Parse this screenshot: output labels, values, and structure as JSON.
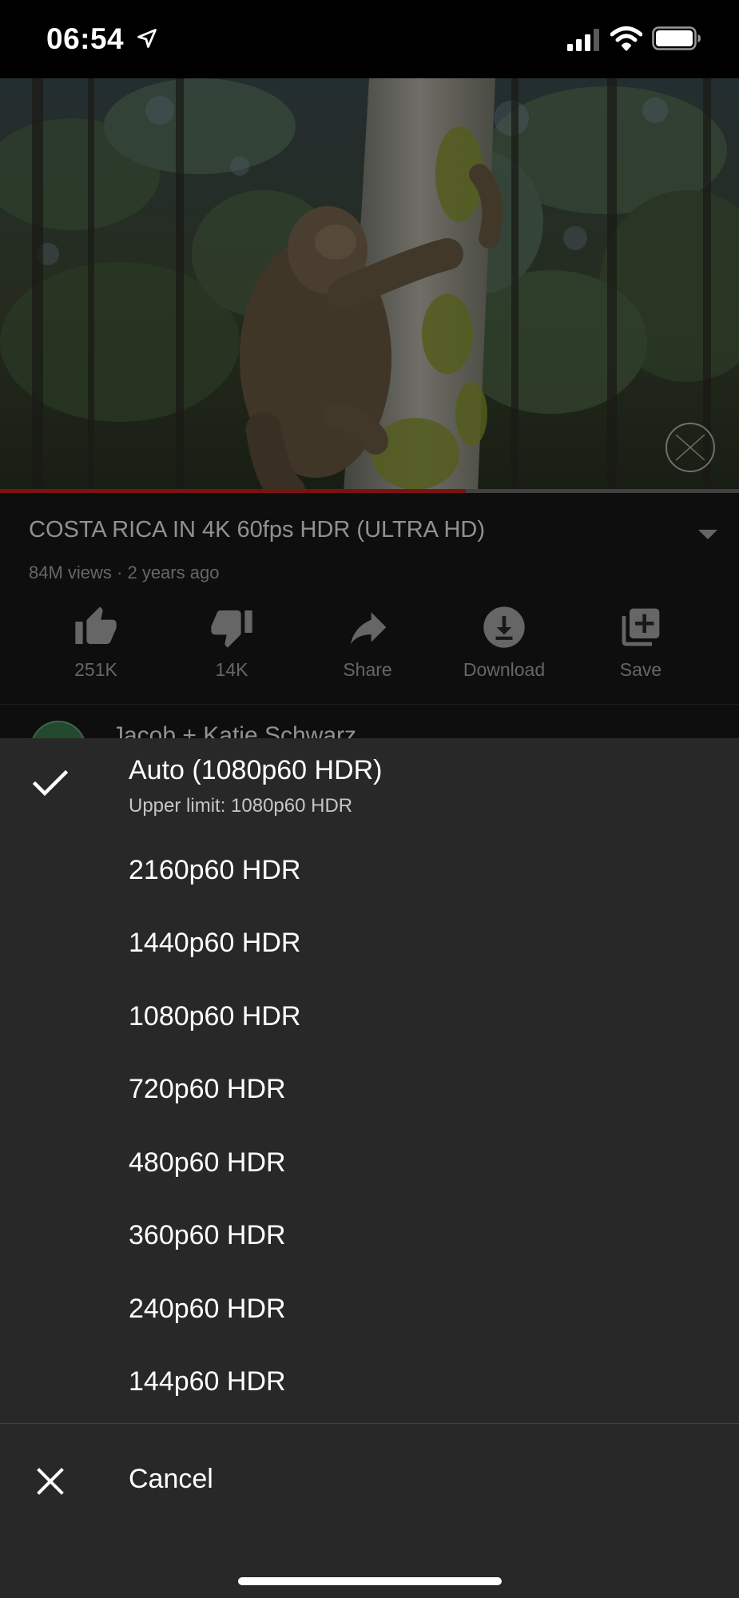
{
  "status_bar": {
    "time": "06:54",
    "icons": [
      "location-arrow-icon",
      "cellular-signal-icon",
      "wifi-icon",
      "battery-icon"
    ]
  },
  "video": {
    "title": "COSTA RICA IN 4K 60fps HDR (ULTRA HD)",
    "meta": "84M views · 2 years ago",
    "progress": 0.63,
    "watermark_icon": "channel-watermark-icon",
    "colors": {
      "progress_played": "#cc1e1e",
      "progress_track": "#6d6d6d"
    }
  },
  "actions": [
    {
      "id": "like",
      "label": "251K",
      "icon": "thumbs-up-icon"
    },
    {
      "id": "dislike",
      "label": "14K",
      "icon": "thumbs-down-icon"
    },
    {
      "id": "share",
      "label": "Share",
      "icon": "share-icon"
    },
    {
      "id": "download",
      "label": "Download",
      "icon": "download-icon"
    },
    {
      "id": "save",
      "label": "Save",
      "icon": "add-to-playlist-icon"
    }
  ],
  "channel": {
    "name": "Jacob + Katie Schwarz"
  },
  "quality_sheet": {
    "auto": {
      "label": "Auto (1080p60 HDR)",
      "sublabel": "Upper limit: 1080p60 HDR",
      "selected": true
    },
    "options": [
      "2160p60 HDR",
      "1440p60 HDR",
      "1080p60 HDR",
      "720p60 HDR",
      "480p60 HDR",
      "360p60 HDR",
      "240p60 HDR",
      "144p60 HDR"
    ],
    "cancel_label": "Cancel"
  }
}
